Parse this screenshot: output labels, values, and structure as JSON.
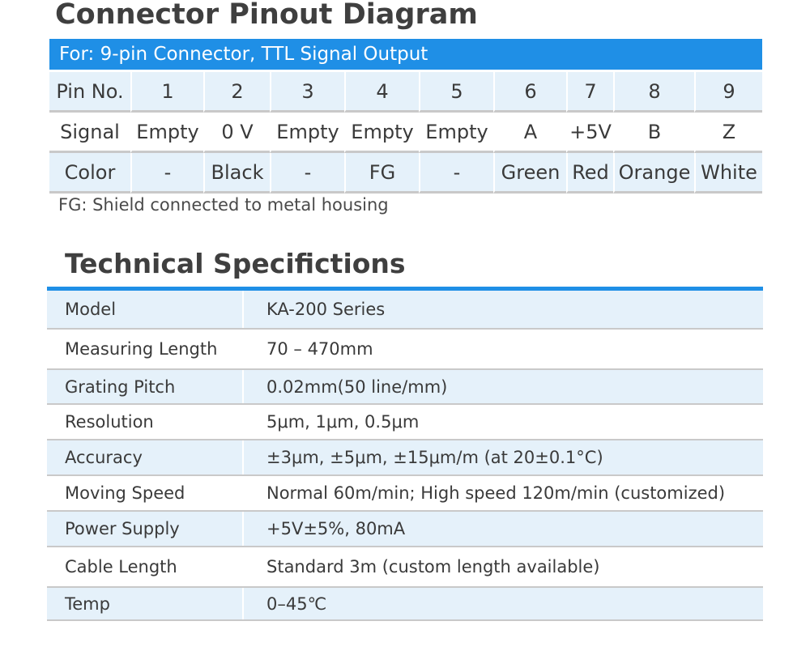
{
  "pinout": {
    "title": "Connector Pinout Diagram",
    "subtitle": "For: 9-pin Connector, TTL Signal Output",
    "rows": [
      {
        "label": "Pin No.",
        "cells": [
          "1",
          "2",
          "3",
          "4",
          "5",
          "6",
          "7",
          "8",
          "9"
        ]
      },
      {
        "label": "Signal",
        "cells": [
          "Empty",
          "0 V",
          "Empty",
          "Empty",
          "Empty",
          "A",
          "+5V",
          "B",
          "Z"
        ]
      },
      {
        "label": "Color",
        "cells": [
          "-",
          "Black",
          "-",
          "FG",
          "-",
          "Green",
          "Red",
          "Orange",
          "White"
        ]
      }
    ],
    "note": "FG: Shield connected to metal housing"
  },
  "specs": {
    "title": "Technical Specifictions",
    "rows": [
      {
        "key": "Model",
        "value": "KA-200 Series"
      },
      {
        "key": "Measuring Length",
        "value": "70 – 470mm"
      },
      {
        "key": "Grating Pitch",
        "value": "0.02mm(50 line/mm)"
      },
      {
        "key": "Resolution",
        "value": "5μm, 1μm, 0.5μm"
      },
      {
        "key": "Accuracy",
        "value": "±3μm, ±5μm, ±15μm/m (at 20±0.1°C)"
      },
      {
        "key": "Moving Speed",
        "value": "Normal 60m/min; High speed 120m/min (customized)"
      },
      {
        "key": "Power Supply",
        "value": "+5V±5%, 80mA"
      },
      {
        "key": "Cable Length",
        "value": "Standard 3m (custom length available)"
      },
      {
        "key": "Temp",
        "value": "0–45℃"
      }
    ]
  },
  "colors": {
    "accent": "#1f8fe6",
    "row_tint": "#e5f1fa",
    "divider": "#c9c9c9"
  }
}
